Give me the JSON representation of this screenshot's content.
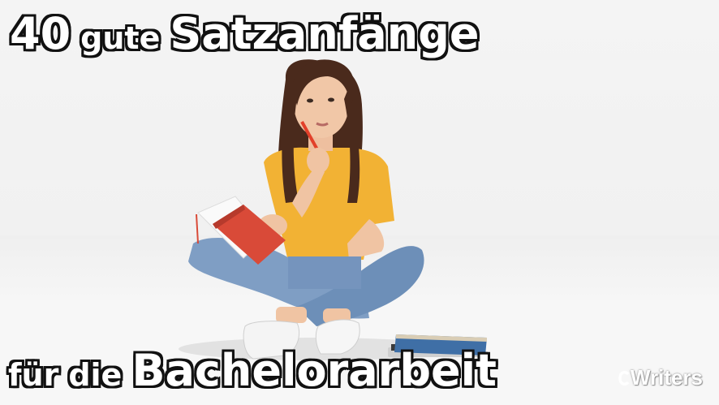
{
  "headline": {
    "line1_number": "40",
    "line1_word1": "gute",
    "line1_word2": "Satzanfänge",
    "line2_word1": "für",
    "line2_word2": "die",
    "line2_word3": "Bachelorarbeit"
  },
  "logo": {
    "text": "Writers",
    "icon": "c-letter-icon"
  }
}
